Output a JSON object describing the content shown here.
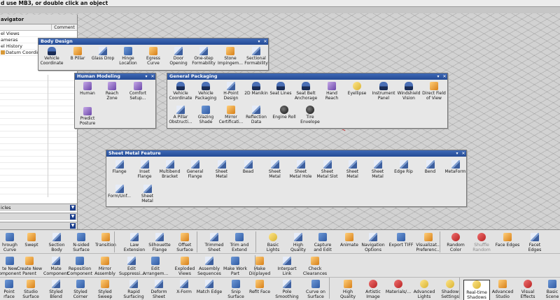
{
  "status_text": "d use MB3, or double click an object",
  "navigator": {
    "title": "avigator",
    "col_comment": "Comment",
    "items": [
      "el Views",
      "ameras",
      "el History",
      "Datum Coordinat"
    ],
    "panels": [
      {
        "label": "icles"
      },
      {
        "label": ""
      },
      {
        "label": ""
      }
    ]
  },
  "toolbars": {
    "body_design": {
      "title": "Body Design",
      "tools": [
        {
          "label": "Vehicle\nCoordinate",
          "icon": "vehicle-coordinate-icon"
        },
        {
          "label": "B Pillar",
          "icon": "b-pillar-icon"
        },
        {
          "label": "Glass Drop",
          "icon": "glass-drop-icon"
        },
        {
          "label": "Hinge\nLocation",
          "icon": "hinge-location-icon"
        },
        {
          "label": "Egress\nCurve",
          "icon": "egress-curve-icon"
        },
        {
          "label": "Door\nOpening",
          "icon": "door-opening-icon"
        },
        {
          "label": "One-step\nFormability",
          "icon": "one-step-formability-icon"
        },
        {
          "label": "Stone\nImpingem...",
          "icon": "stone-impingement-icon"
        },
        {
          "label": "Sectional\nFormability",
          "icon": "sectional-formability-icon"
        }
      ]
    },
    "human_modeling": {
      "title": "Human Modeling",
      "tools": [
        {
          "label": "Human",
          "icon": "human-icon"
        },
        {
          "label": "Reach\nZone",
          "icon": "reach-zone-icon"
        },
        {
          "label": "Comfort\nSetup...",
          "icon": "comfort-setup-icon"
        },
        {
          "label": "Predict\nPosture",
          "icon": "predict-posture-icon"
        }
      ]
    },
    "general_packaging": {
      "title": "General Packaging",
      "tools": [
        {
          "label": "Vehicle\nCoordinate",
          "icon": "vehicle-coordinate-icon"
        },
        {
          "label": "Vehicle\nPackaging",
          "icon": "vehicle-packaging-icon"
        },
        {
          "label": "H-Point\nDesign",
          "icon": "h-point-design-icon"
        },
        {
          "label": "2D Manikin",
          "icon": "manikin-icon"
        },
        {
          "label": "Seat Lines",
          "icon": "seat-lines-icon"
        },
        {
          "label": "Seat Belt\nAnchorage",
          "icon": "seat-belt-icon"
        },
        {
          "label": "Hand\nReach",
          "icon": "hand-reach-icon"
        },
        {
          "label": "Eyellipse",
          "icon": "eyellipse-icon"
        },
        {
          "label": "Instrument\nPanel",
          "icon": "instrument-panel-icon"
        },
        {
          "label": "Windshield\nVision",
          "icon": "windshield-vision-icon"
        },
        {
          "label": "Direct Field\nof View",
          "icon": "direct-field-of-view-icon"
        },
        {
          "label": "A Pillar\nObstructi...",
          "icon": "a-pillar-icon"
        },
        {
          "label": "Glazing\nShade",
          "icon": "glazing-shade-icon"
        },
        {
          "label": "Mirror\nCertificati...",
          "icon": "mirror-certification-icon"
        },
        {
          "label": "Reflection\nData",
          "icon": "reflection-data-icon"
        },
        {
          "label": "Engine Roll",
          "icon": "engine-roll-icon"
        },
        {
          "label": "Tire\nEnvelope",
          "icon": "tire-envelope-icon"
        }
      ]
    },
    "sheet_metal": {
      "title": "Sheet Metal Feature",
      "tools": [
        {
          "label": "Flange",
          "icon": "flange-icon"
        },
        {
          "label": "Inset\nFlange",
          "icon": "inset-flange-icon"
        },
        {
          "label": "Multibend\nBracket",
          "icon": "multibend-bracket-icon"
        },
        {
          "label": "General\nFlange",
          "icon": "general-flange-icon"
        },
        {
          "label": "Sheet\nMetal",
          "icon": "sheet-metal-icon"
        },
        {
          "label": "Bead",
          "icon": "bead-icon"
        },
        {
          "label": "Sheet\nMetal",
          "icon": "sheet-metal-icon"
        },
        {
          "label": "Sheet\nMetal Hole",
          "icon": "sheet-metal-hole-icon"
        },
        {
          "label": "Sheet\nMetal Slot",
          "icon": "sheet-metal-slot-icon"
        },
        {
          "label": "Sheet\nMetal",
          "icon": "sheet-metal-icon"
        },
        {
          "label": "Sheet\nMetal",
          "icon": "sheet-metal-icon"
        },
        {
          "label": "Edge Rip",
          "icon": "edge-rip-icon"
        },
        {
          "label": "Bend",
          "icon": "bend-icon"
        },
        {
          "label": "MetaForm",
          "icon": "metaform-icon"
        },
        {
          "label": "Form/Unf...",
          "icon": "form-unform-icon"
        },
        {
          "label": "Sheet\nMetal",
          "icon": "sheet-metal-icon"
        }
      ]
    }
  },
  "ribbon": {
    "row1": [
      {
        "label": "hrough\nCurve",
        "icon": "through-curve-icon"
      },
      {
        "label": "Swept",
        "icon": "swept-icon"
      },
      {
        "label": "Section\nBody",
        "icon": "section-body-icon"
      },
      {
        "label": "N-sided\nSurface",
        "icon": "n-sided-surface-icon"
      },
      {
        "label": "Transition",
        "icon": "transition-icon"
      },
      {
        "label": "Law\nExtension",
        "icon": "law-extension-icon"
      },
      {
        "label": "Silhouette\nFlange",
        "icon": "silhouette-flange-icon"
      },
      {
        "label": "Offset\nSurface",
        "icon": "offset-surface-icon"
      },
      {
        "label": "Trimmed\nSheet",
        "icon": "trimmed-sheet-icon"
      },
      {
        "label": "Trim and\nExtend",
        "icon": "trim-extend-icon"
      },
      {
        "label": "Basic\nLights",
        "icon": "basic-lights-icon"
      },
      {
        "label": "High\nQuality",
        "icon": "high-quality-icon"
      },
      {
        "label": "Capture\nand Edit",
        "icon": "capture-edit-icon"
      },
      {
        "label": "Animate",
        "icon": "animate-icon"
      },
      {
        "label": "Navigation\nOptions",
        "icon": "navigation-options-icon"
      },
      {
        "label": "Export TIFF",
        "icon": "export-tiff-icon"
      },
      {
        "label": "Visualizat...\nPreferenc...",
        "icon": "visualization-preferences-icon"
      },
      {
        "label": "Random\nColor",
        "icon": "random-color-icon"
      },
      {
        "label": "Shuffle\nRandom",
        "icon": "shuffle-random-icon",
        "disabled": true
      },
      {
        "label": "Face Edges",
        "icon": "face-edges-icon"
      },
      {
        "label": "Facet\nEdges",
        "icon": "facet-edges-icon"
      }
    ],
    "row2": [
      {
        "label": "te New\nomponent",
        "icon": "create-component-icon"
      },
      {
        "label": "Create New\nParent",
        "icon": "create-parent-icon"
      },
      {
        "label": "Mate\nComponent",
        "icon": "mate-component-icon"
      },
      {
        "label": "Reposition\nComponent",
        "icon": "reposition-component-icon"
      },
      {
        "label": "Mirror\nAssembly",
        "icon": "mirror-assembly-icon"
      },
      {
        "label": "Edit\nSuppressi...",
        "icon": "edit-suppression-icon"
      },
      {
        "label": "Edit\nArrangem...",
        "icon": "edit-arrangement-icon"
      },
      {
        "label": "Exploded\nViews",
        "icon": "exploded-views-icon"
      },
      {
        "label": "Assembly\nSequences",
        "icon": "assembly-sequences-icon"
      },
      {
        "label": "Make Work\nPart",
        "icon": "make-work-part-icon"
      },
      {
        "label": "Make\nDisplayed",
        "icon": "make-displayed-icon"
      },
      {
        "label": "Interpart\nLink",
        "icon": "interpart-link-icon"
      },
      {
        "label": "Check\nClearances",
        "icon": "check-clearances-icon"
      }
    ],
    "row3": [
      {
        "label": "Point\nrface",
        "icon": "point-surface-icon"
      },
      {
        "label": "Studio\nSurface",
        "icon": "studio-surface-icon"
      },
      {
        "label": "Styled\nBlend",
        "icon": "styled-blend-icon"
      },
      {
        "label": "Styled\nCorner",
        "icon": "styled-corner-icon"
      },
      {
        "label": "Styled\nSweep",
        "icon": "styled-sweep-icon"
      },
      {
        "label": "Rapid\nSurfacing",
        "icon": "rapid-surfacing-icon"
      },
      {
        "label": "Deform\nSheet",
        "icon": "deform-sheet-icon"
      },
      {
        "label": "X-Form",
        "icon": "x-form-icon"
      },
      {
        "label": "Match Edge",
        "icon": "match-edge-icon"
      },
      {
        "label": "Snip\nSurface",
        "icon": "snip-surface-icon"
      },
      {
        "label": "Refit Face",
        "icon": "refit-face-icon"
      },
      {
        "label": "Pole\nSmoothing",
        "icon": "pole-smoothing-icon"
      },
      {
        "label": "Curve on\nSurface",
        "icon": "curve-on-surface-icon"
      },
      {
        "label": "High\nQuality",
        "icon": "high-quality-icon"
      },
      {
        "label": "Artistic\nImage",
        "icon": "artistic-image-icon"
      },
      {
        "label": "Materials/...",
        "icon": "materials-icon"
      },
      {
        "label": "Advanced\nLights",
        "icon": "advanced-lights-icon"
      },
      {
        "label": "Shadow\nSettings",
        "icon": "shadow-settings-icon"
      },
      {
        "label": "Real-time\nShadows",
        "icon": "realtime-shadows-icon",
        "active": true
      },
      {
        "label": "Advanced\nStudio",
        "icon": "advanced-studio-icon"
      },
      {
        "label": "Visual\nEffects",
        "icon": "visual-effects-icon"
      },
      {
        "label": "Basic\nScene",
        "icon": "basic-scene-icon"
      }
    ]
  },
  "colors": {
    "title_bar": "#2d56a3",
    "panel": "#e7e7e7",
    "viewport": "#d2d2d2"
  }
}
